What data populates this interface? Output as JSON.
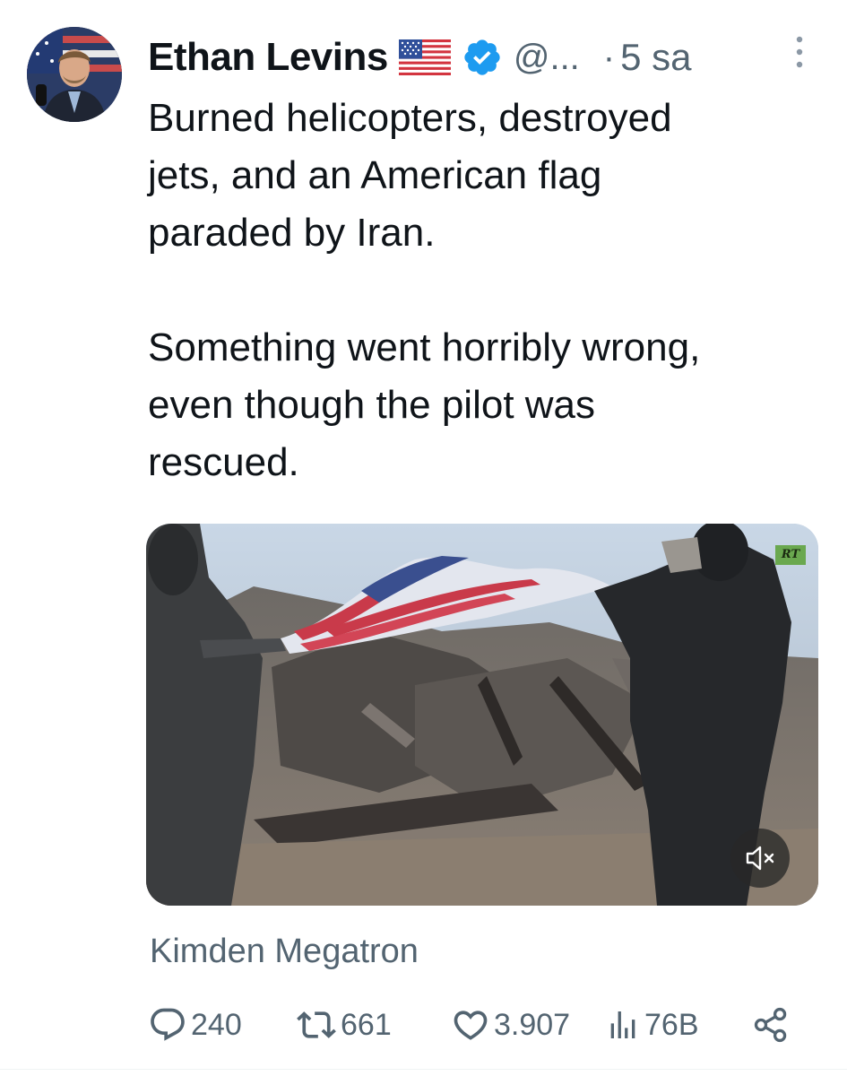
{
  "tweet": {
    "author": {
      "display_name": "Ethan Levins",
      "handle": "@...",
      "flag_icon": "us-flag-icon",
      "verified_icon": "verified-badge-icon"
    },
    "separator": "·",
    "timestamp": "5 sa",
    "text_lines": [
      "Burned helicopters, destroyed",
      "jets, and an American flag",
      "paraded by Iran."
    ],
    "text_lines_2": [
      "Something went horribly wrong,",
      "even though the pilot was",
      "rescued."
    ],
    "media": {
      "watermark": "RT",
      "mute_icon": "speaker-muted-icon"
    },
    "source_label": "Kimden Megatron",
    "stats": {
      "replies": "240",
      "reposts": "661",
      "likes": "3.907",
      "views": "76B"
    },
    "colors": {
      "text": "#0f1419",
      "secondary": "#536471",
      "verified": "#1d9bf0"
    }
  }
}
